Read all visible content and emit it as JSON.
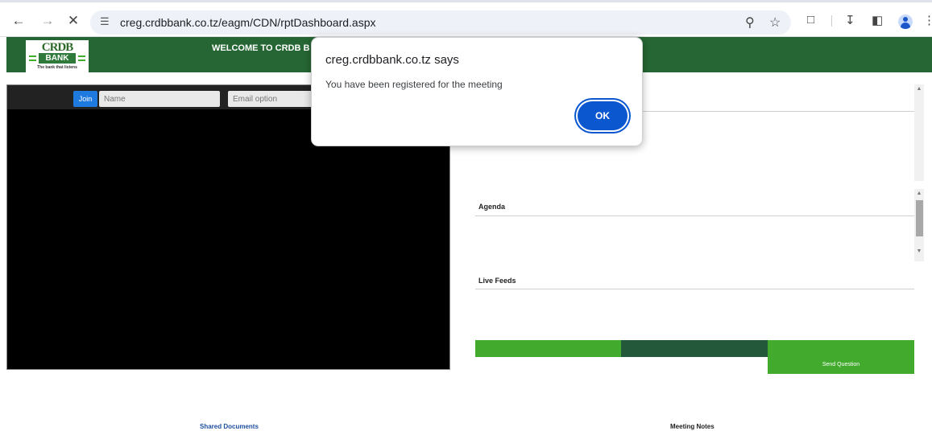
{
  "browser": {
    "back_icon": "back-arrow-icon",
    "forward_icon": "forward-arrow-icon",
    "stop_icon": "close-icon",
    "url": "creg.crdbbank.co.tz/eagm/CDN/rptDashboard.aspx"
  },
  "header": {
    "logo": {
      "brand": "CRDB",
      "bank": "BANK",
      "tagline": "The bank that listens"
    },
    "welcome": "WELCOME TO CRDB B"
  },
  "video": {
    "join_label": "Join",
    "name_placeholder": "Name",
    "email_placeholder": "Email option"
  },
  "sections": {
    "agenda": "Agenda",
    "live_feeds": "Live Feeds"
  },
  "send_question_label": "Send Question",
  "footer": {
    "shared_documents": "Shared Documents",
    "meeting_notes": "Meeting Notes"
  },
  "dialog": {
    "title": "creg.crdbbank.co.tz says",
    "message": "You have been registered for the meeting",
    "ok_label": "OK"
  },
  "colors": {
    "header_green": "#266634",
    "accent_green": "#42ab2e",
    "dark_green": "#23583a",
    "dialog_button": "#0b57d0"
  }
}
